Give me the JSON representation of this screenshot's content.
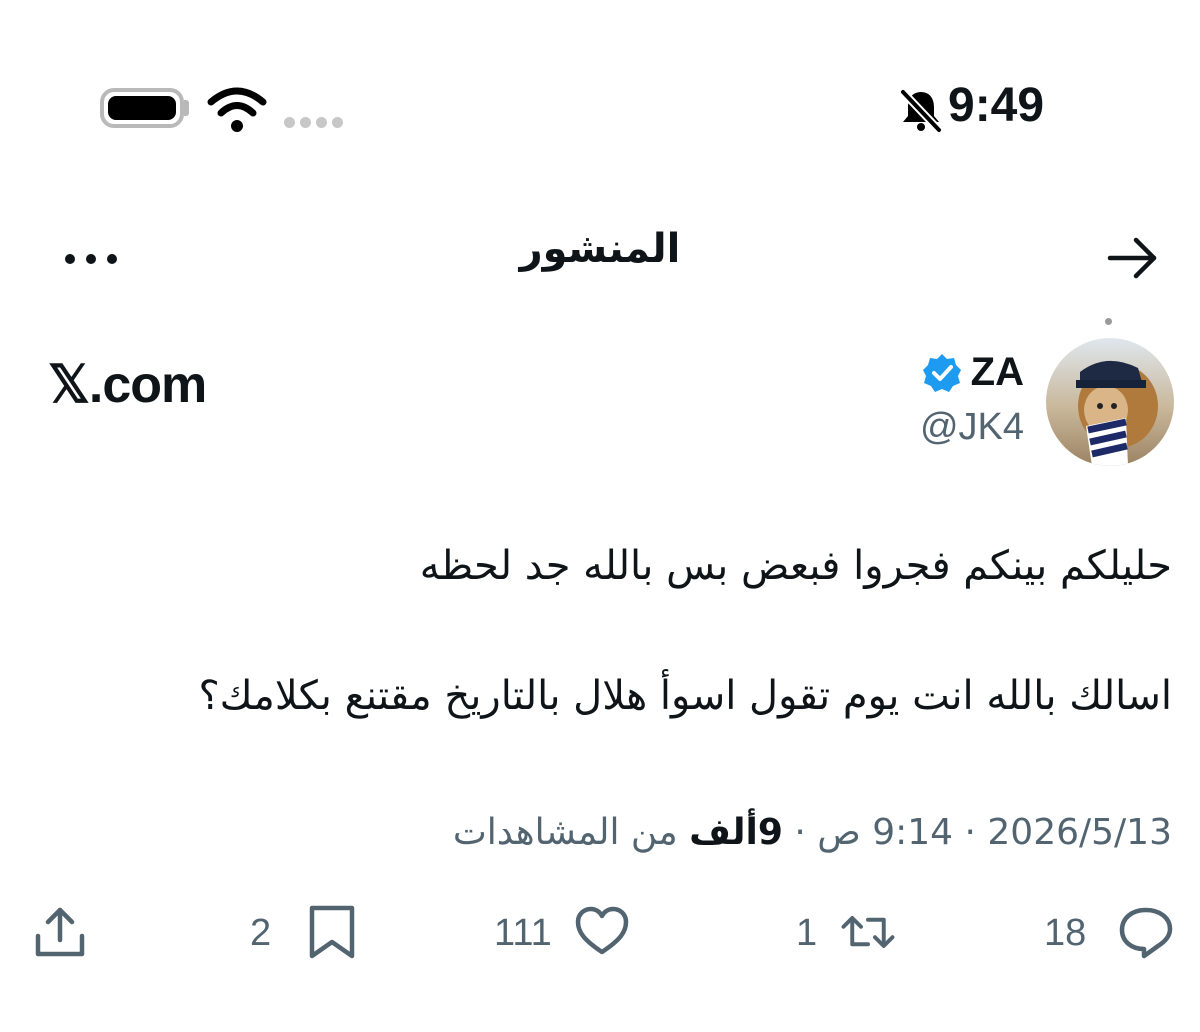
{
  "status_bar": {
    "time": "9:49",
    "icons": [
      "battery-icon",
      "wifi-icon",
      "signal-icon",
      "bell-muted-icon"
    ]
  },
  "header": {
    "title": "المنشور",
    "icons": [
      "back-arrow-icon",
      "more-icon"
    ]
  },
  "author": {
    "name": "ZA",
    "handle": "@JK4",
    "verified": true,
    "accent": "#1d9bf0"
  },
  "watermark": "𝕏.com",
  "tweet": {
    "lines": [
      "حليلكم بينكم فجروا فبعض بس بالله جد لحظه",
      "اسالك بالله انت يوم تقول اسوأ هلال بالتاريخ مقتنع بكلامك؟"
    ]
  },
  "meta": {
    "date": "2026/5/13",
    "time": "9:14 ص",
    "separator": "·",
    "views_count": "9ألف",
    "views_label": "من المشاهدات"
  },
  "actions": {
    "replies": "18",
    "reposts": "1",
    "likes": "111",
    "bookmarks": "2"
  }
}
